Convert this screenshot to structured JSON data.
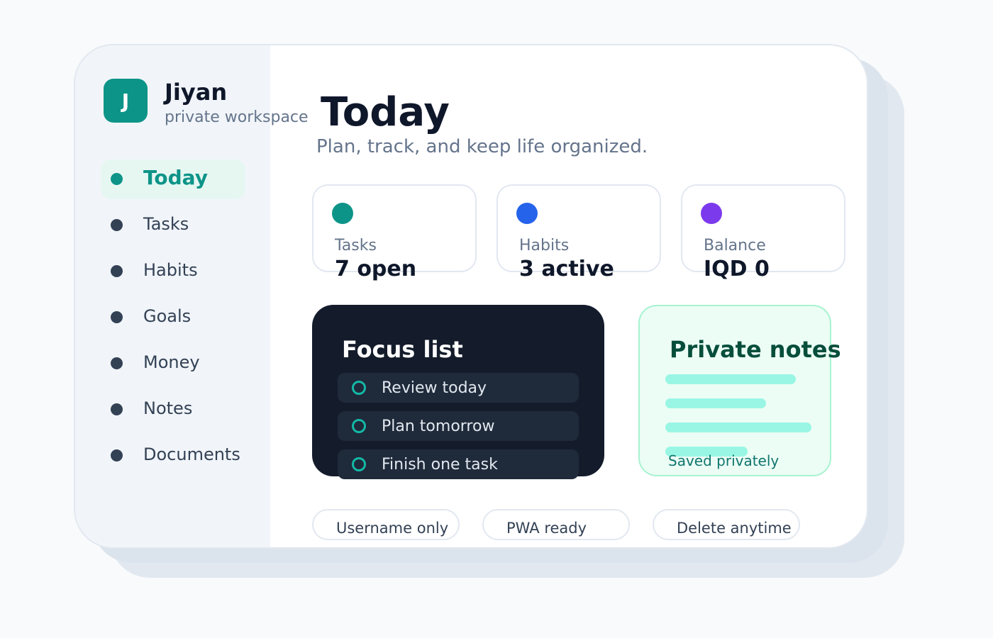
{
  "user": {
    "initial": "J",
    "name": "Jiyan",
    "subtitle": "private workspace"
  },
  "nav": {
    "items": [
      {
        "label": "Today",
        "active": true
      },
      {
        "label": "Tasks"
      },
      {
        "label": "Habits"
      },
      {
        "label": "Goals"
      },
      {
        "label": "Money"
      },
      {
        "label": "Notes"
      },
      {
        "label": "Documents"
      }
    ]
  },
  "main": {
    "title": "Today",
    "subtitle": "Plan, track, and keep life organized."
  },
  "stats": [
    {
      "label": "Tasks",
      "value": "7 open",
      "color": "#0d9488"
    },
    {
      "label": "Habits",
      "value": "3 active",
      "color": "#2563eb"
    },
    {
      "label": "Balance",
      "value": "IQD 0",
      "color": "#7c3aed"
    }
  ],
  "focus": {
    "title": "Focus list",
    "items": [
      "Review today",
      "Plan tomorrow",
      "Finish one task"
    ]
  },
  "notes": {
    "title": "Private notes",
    "caption": "Saved privately"
  },
  "pills": [
    "Username only",
    "PWA ready",
    "Delete anytime"
  ],
  "colors": {
    "accent": "#0d9488",
    "focus_bg": "#141c2b",
    "notes_bg": "#ecfdf5",
    "sidebar_bg": "#f1f5f9"
  }
}
